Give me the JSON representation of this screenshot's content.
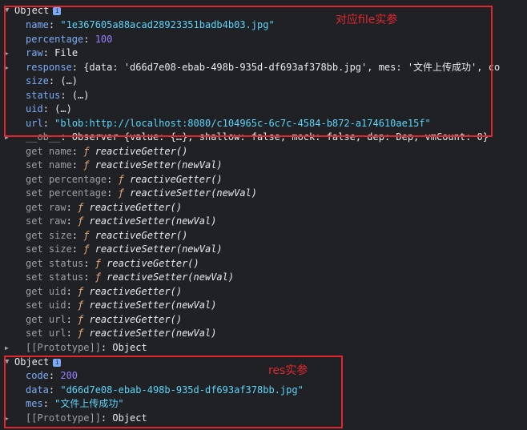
{
  "obj1": {
    "header": "Object",
    "props": [
      {
        "key": "name",
        "value": "\"1e367605a88acad28923351badb4b03.jpg\"",
        "vclass": "s"
      },
      {
        "key": "percentage",
        "value": "100",
        "vclass": "n"
      },
      {
        "key": "raw",
        "value": "File",
        "vclass": "punct",
        "expandable": true
      },
      {
        "key": "response",
        "value": "{data: 'd66d7e08-ebab-498b-935d-df693af378bb.jpg', mes: '文件上传成功', co",
        "vclass": "punct",
        "expandable": true
      },
      {
        "key": "size",
        "value": "(…)",
        "vclass": "punct"
      },
      {
        "key": "status",
        "value": "(…)",
        "vclass": "punct"
      },
      {
        "key": "uid",
        "value": "(…)",
        "vclass": "punct"
      },
      {
        "key": "url",
        "value": "\"blob:http://localhost:8080/c104965c-6c7c-4584-b872-a174610ae15f\"",
        "vclass": "s"
      }
    ],
    "ob": {
      "key": "__ob__",
      "value": "Observer {value: {…}, shallow: false, mock: false, dep: Dep, vmCount: 0}"
    },
    "accessors": [
      {
        "label": "get name",
        "fn": "reactiveGetter()"
      },
      {
        "label": "set name",
        "fn": "reactiveSetter(newVal)"
      },
      {
        "label": "get percentage",
        "fn": "reactiveGetter()"
      },
      {
        "label": "set percentage",
        "fn": "reactiveSetter(newVal)"
      },
      {
        "label": "get raw",
        "fn": "reactiveGetter()"
      },
      {
        "label": "set raw",
        "fn": "reactiveSetter(newVal)"
      },
      {
        "label": "get size",
        "fn": "reactiveGetter()"
      },
      {
        "label": "set size",
        "fn": "reactiveSetter(newVal)"
      },
      {
        "label": "get status",
        "fn": "reactiveGetter()"
      },
      {
        "label": "set status",
        "fn": "reactiveSetter(newVal)"
      },
      {
        "label": "get uid",
        "fn": "reactiveGetter()"
      },
      {
        "label": "set uid",
        "fn": "reactiveSetter(newVal)"
      },
      {
        "label": "get url",
        "fn": "reactiveGetter()"
      },
      {
        "label": "set url",
        "fn": "reactiveSetter(newVal)"
      }
    ],
    "prototype": {
      "key": "[[Prototype]]",
      "value": "Object"
    },
    "annotation": "对应file实参"
  },
  "obj2": {
    "header": "Object",
    "props": [
      {
        "key": "code",
        "value": "200",
        "vclass": "n"
      },
      {
        "key": "data",
        "value": "\"d66d7e08-ebab-498b-935d-df693af378bb.jpg\"",
        "vclass": "s"
      },
      {
        "key": "mes",
        "value": "\"文件上传成功\"",
        "vclass": "s"
      }
    ],
    "prototype": {
      "key": "[[Prototype]]",
      "value": "Object"
    },
    "annotation": "res实参"
  },
  "fsym": "ƒ",
  "colors": {
    "annotation": "#e0272f",
    "key": "#7cacf8",
    "string": "#5cd5fb",
    "number": "#9980ff"
  }
}
